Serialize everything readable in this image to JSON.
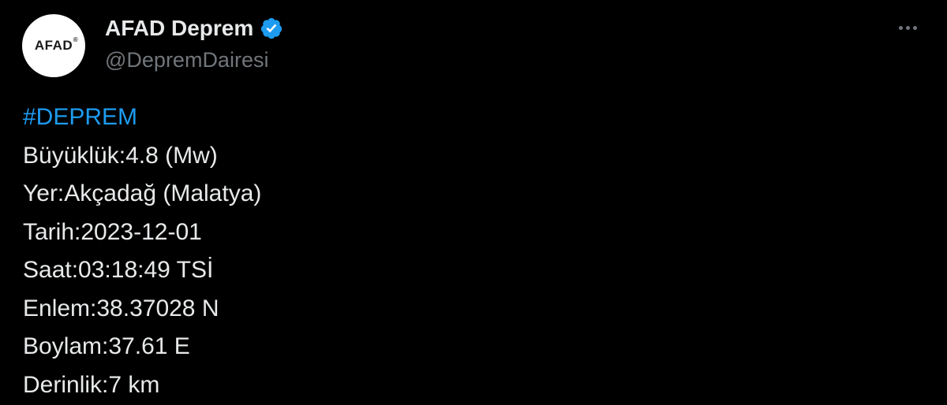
{
  "colors": {
    "background": "#000000",
    "text": "#e7e9ea",
    "secondary_text": "#71767b",
    "link": "#1d9bf0",
    "verified_badge": "#1d9bf0"
  },
  "author": {
    "avatar_text": "AFAD",
    "avatar_mark": "®",
    "display_name": "AFAD Deprem",
    "verified_icon": "verified-badge-icon",
    "handle": "@DepremDairesi"
  },
  "more_icon": "more-horizontal-icon",
  "tweet": {
    "hashtag": "#DEPREM",
    "lines": [
      "Büyüklük:4.8 (Mw)",
      "Yer:Akçadağ (Malatya)",
      "Tarih:2023-12-01",
      "Saat:03:18:49 TSİ",
      "Enlem:38.37028 N",
      "Boylam:37.61 E",
      "Derinlik:7 km"
    ]
  }
}
